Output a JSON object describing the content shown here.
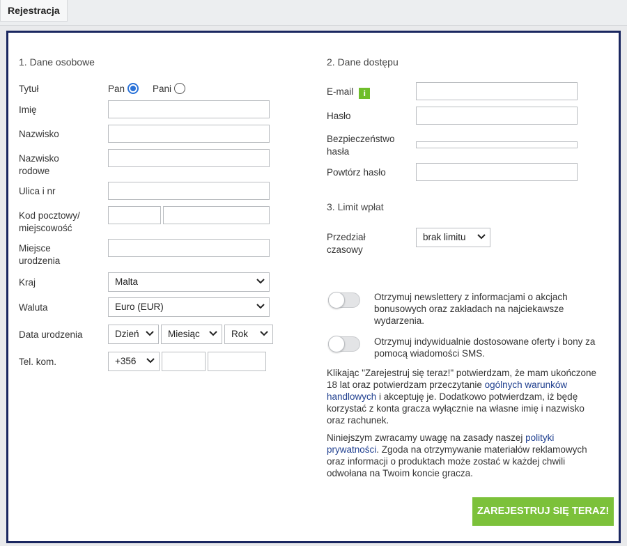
{
  "tab": {
    "label": "Rejestracja"
  },
  "personal": {
    "section_title": "1. Dane osobowe",
    "title_label": "Tytuł",
    "title_options": [
      {
        "label": "Pan",
        "selected": true
      },
      {
        "label": "Pani",
        "selected": false
      }
    ],
    "first_name_label": "Imię",
    "last_name_label": "Nazwisko",
    "birth_name_label_1": "Nazwisko",
    "birth_name_label_2": "rodowe",
    "street_label": "Ulica i nr",
    "postal_label_1": "Kod pocztowy/",
    "postal_label_2": "miejscowość",
    "birthplace_label_1": "Miejsce",
    "birthplace_label_2": "urodzenia",
    "country_label": "Kraj",
    "country_value": "Malta",
    "currency_label": "Waluta",
    "currency_value": "Euro (EUR)",
    "dob_label": "Data urodzenia",
    "dob_day": "Dzień",
    "dob_month": "Miesiąc",
    "dob_year": "Rok",
    "phone_label": "Tel. kom.",
    "phone_prefix": "+356"
  },
  "access": {
    "section_title": "2. Dane dostępu",
    "email_label": "E-mail",
    "info_icon": "i",
    "password_label": "Hasło",
    "strength_label_1": "Bezpieczeństwo",
    "strength_label_2": "hasła",
    "repeat_label": "Powtórz hasło"
  },
  "limit": {
    "section_title": "3. Limit wpłat",
    "period_label_1": "Przedział",
    "period_label_2": "czasowy",
    "period_value": "brak limitu"
  },
  "consents": {
    "newsletter_1": "Otrzymuj newslettery z informacjami o akcjach",
    "newsletter_2": "bonusowych oraz zakładach na najciekawsze",
    "newsletter_3": "wydarzenia.",
    "offers_1": "Otrzymuj indywidualnie dostosowane oferty i bony za",
    "offers_2": "pomocą wiadomości SMS."
  },
  "legal": {
    "p1_l1": "Klikając \"Zarejestruj się teraz!\" potwierdzam, że mam ukończone",
    "p1_l2a": "18 lat oraz potwierdzam przeczytanie ",
    "p1_l2_link": "ogólnych warunków",
    "p1_l3_link": "handlowych",
    "p1_l3b": " i akceptuję je. Dodatkowo potwierdzam, iż będę",
    "p1_l4": "korzystać z konta gracza wyłącznie na własne imię i nazwisko",
    "p1_l5": "oraz rachunek.",
    "p2_l1a": "Niniejszym zwracamy uwagę na zasady naszej ",
    "p2_l1_link": "polityki",
    "p2_l2_link": "prywatności",
    "p2_l2b": ". Zgoda na otrzymywanie materiałów reklamowych",
    "p2_l3": "oraz informacji o produktach może zostać w każdej chwili",
    "p2_l4": "odwołana na Twoim koncie gracza."
  },
  "submit": {
    "label": "ZAREJESTRUJ SIĘ TERAZ!"
  }
}
